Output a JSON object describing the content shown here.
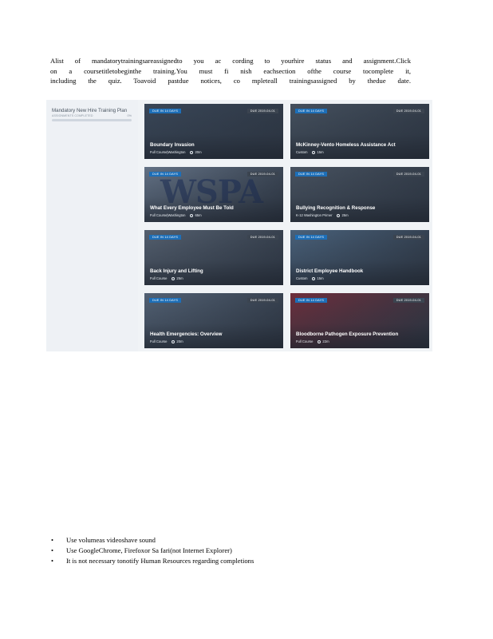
{
  "intro": {
    "lines": [
      "Alist of mandatorytrainingsareassignedto you ac cording to yourhire status and assignment.Click",
      "on a coursetitletobeginthe training.You must fi nish eachsection ofthe course tocomplete it,",
      "including the quiz. Toavoid pastdue notices, co mpleteall trainingsassigned by thedue date."
    ]
  },
  "plan": {
    "title": "Mandatory New Hire Training Plan",
    "subtitle": "ASSIGNMENTS COMPLETED",
    "percent": "0%",
    "progress": 0
  },
  "courses": [
    {
      "title": "Boundary Invasion",
      "type": "Full Course|Washington",
      "duration": "20m",
      "badge_left": "DUE IN 14 DAYS",
      "badge_right": "DUE 2019-04-01",
      "color": "#3c4a5c"
    },
    {
      "title": "McKinney-Vento Homeless Assistance Act",
      "type": "Custom",
      "duration": "15m",
      "badge_left": "DUE IN 14 DAYS",
      "badge_right": "DUE 2019-04-01",
      "color": "#4a5664"
    },
    {
      "title": "What Every Employee Must Be Told",
      "type": "Full Course|Washington",
      "duration": "65m",
      "badge_left": "DUE IN 14 DAYS",
      "badge_right": "DUE 2019-04-01",
      "color": "#6d7d92"
    },
    {
      "title": "Bullying Recognition & Response",
      "type": "K-12 Washington Primer",
      "duration": "25m",
      "badge_left": "DUE IN 14 DAYS",
      "badge_right": "DUE 2019-04-01",
      "color": "#4d5866"
    },
    {
      "title": "Back Injury and Lifting",
      "type": "Full Course",
      "duration": "25m",
      "badge_left": "DUE IN 14 DAYS",
      "badge_right": "DUE 2019-04-01",
      "color": "#5c6878"
    },
    {
      "title": "District Employee Handbook",
      "type": "Custom",
      "duration": "15m",
      "badge_left": "DUE IN 14 DAYS",
      "badge_right": "DUE 2019-04-01",
      "color": "#4f6a86"
    },
    {
      "title": "Health Emergencies: Overview",
      "type": "Full Course",
      "duration": "20m",
      "badge_left": "DUE IN 14 DAYS",
      "badge_right": "DUE 2019-04-01",
      "color": "#5a6a7e"
    },
    {
      "title": "Bloodborne Pathogen Exposure Prevention",
      "type": "Full Course",
      "duration": "22m",
      "badge_left": "DUE IN 14 DAYS",
      "badge_right": "DUE 2019-04-01",
      "color": "#7a2e3c"
    }
  ],
  "bullets": [
    "Use volumeas videoshave sound",
    "Use GoogleChrome, Firefoxor Sa fari(not Internet Explorer)",
    "It is not necessary tonotify Human Resources regarding completions"
  ],
  "bullet_char": "•"
}
